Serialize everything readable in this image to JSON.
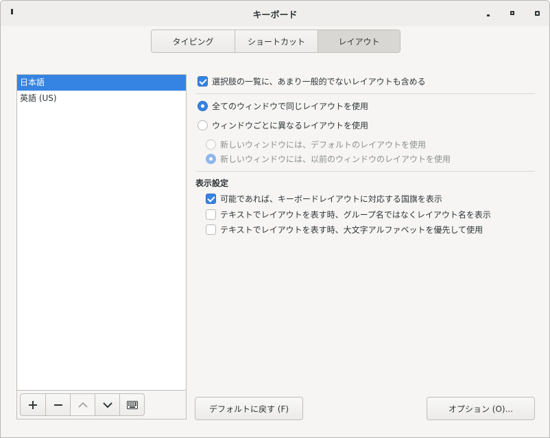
{
  "window": {
    "title": "キーボード"
  },
  "tabs": [
    {
      "label": "タイピング"
    },
    {
      "label": "ショートカット"
    },
    {
      "label": "レイアウト",
      "selected": true
    }
  ],
  "layouts": {
    "items": [
      {
        "label": "日本語",
        "selected": true
      },
      {
        "label": "英語 (US)",
        "selected": false
      }
    ],
    "toolbar": {
      "add": "+",
      "remove": "−",
      "up": "^",
      "down": "v",
      "keyboard": "keyboard-icon"
    }
  },
  "options": {
    "show_uncommon": {
      "label": "選択肢の一覧に、あまり一般的でないレイアウトも含める",
      "checked": true
    },
    "same_layout_all": {
      "label": "全てのウィンドウで同じレイアウトを使用",
      "checked": true
    },
    "per_window": {
      "label": "ウィンドウごとに異なるレイアウトを使用",
      "checked": false
    },
    "new_window_default": {
      "label": "新しいウィンドウには、デフォルトのレイアウトを使用",
      "checked": false,
      "disabled": true
    },
    "new_window_previous": {
      "label": "新しいウィンドウには、以前のウィンドウのレイアウトを使用",
      "checked": true,
      "disabled": true
    }
  },
  "display": {
    "heading": "表示設定",
    "show_flags": {
      "label": "可能であれば、キーボードレイアウトに対応する国旗を表示",
      "checked": true
    },
    "show_layout_name": {
      "label": "テキストでレイアウトを表す時、グループ名ではなくレイアウト名を表示",
      "checked": false
    },
    "prefer_capitals": {
      "label": "テキストでレイアウトを表す時、大文字アルファベットを優先して使用",
      "checked": false
    }
  },
  "buttons": {
    "reset": "デフォルトに戻す (F)",
    "options": "オプション (O)..."
  },
  "colors": {
    "accent": "#3584e4"
  }
}
